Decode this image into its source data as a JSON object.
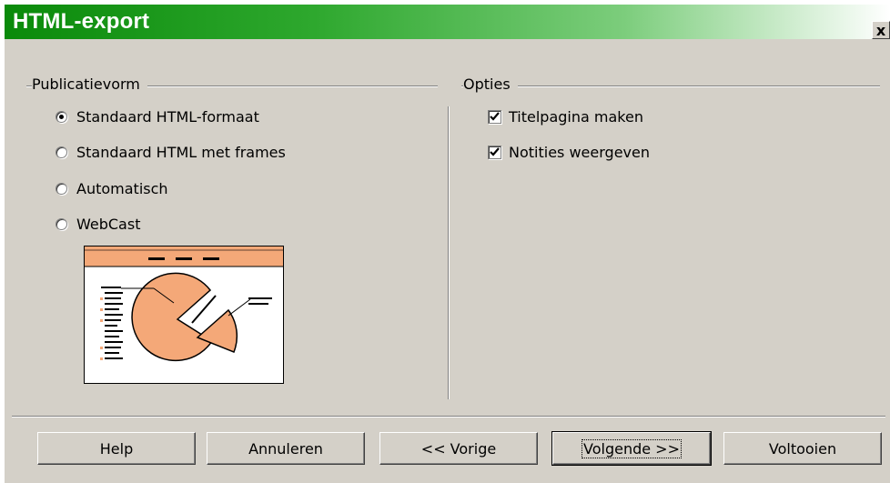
{
  "window": {
    "title": "HTML-export",
    "close_glyph": "x"
  },
  "publication": {
    "group_label": "Publicatievorm",
    "options": [
      {
        "label": "Standaard HTML-formaat",
        "checked": true
      },
      {
        "label": "Standaard HTML met frames",
        "checked": false
      },
      {
        "label": "Automatisch",
        "checked": false
      },
      {
        "label": "WebCast",
        "checked": false
      }
    ]
  },
  "options": {
    "group_label": "Opties",
    "checkboxes": [
      {
        "label": "Titelpagina maken",
        "checked": true
      },
      {
        "label": "Notities weergeven",
        "checked": true
      }
    ]
  },
  "buttons": {
    "help": "Help",
    "cancel": "Annuleren",
    "previous": "<< Vorige",
    "next": "Volgende >>",
    "finish": "Voltooien"
  },
  "colors": {
    "titlebar_start": "#0a8a0a",
    "dialog_bg": "#d4d0c8",
    "preview_accent": "#f4a878"
  }
}
